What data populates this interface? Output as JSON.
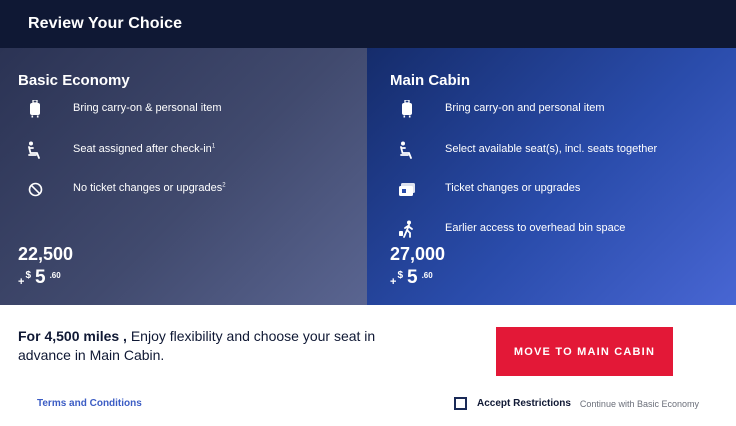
{
  "header": {
    "title": "Review Your Choice"
  },
  "basic": {
    "title": "Basic Economy",
    "features": [
      {
        "icon": "carry-on-bag-icon",
        "text": "Bring carry-on & personal item",
        "sup": ""
      },
      {
        "icon": "seat-icon",
        "text": "Seat assigned after check-in",
        "sup": "1"
      },
      {
        "icon": "no-symbol-icon",
        "text": "No ticket changes or upgrades",
        "sup": "2"
      }
    ],
    "miles": "22,500",
    "price": {
      "plus": "+",
      "currency": "$",
      "dollars": "5",
      "cents": ".60"
    }
  },
  "main": {
    "title": "Main Cabin",
    "features": [
      {
        "icon": "carry-on-bag-icon",
        "text": "Bring carry-on and personal item"
      },
      {
        "icon": "seat-icon",
        "text": "Select available seat(s), incl. seats together"
      },
      {
        "icon": "ticket-icon",
        "text": "Ticket changes or upgrades"
      },
      {
        "icon": "boarding-person-icon",
        "text": "Earlier access to overhead bin space"
      }
    ],
    "miles": "27,000",
    "price": {
      "plus": "+",
      "currency": "$",
      "dollars": "5",
      "cents": ".60"
    }
  },
  "upsell": {
    "highlight": "For 4,500 miles ,",
    "text": " Enjoy flexibility and choose your seat in advance in Main Cabin."
  },
  "cta": {
    "label": "MOVE TO MAIN CABIN"
  },
  "footer": {
    "terms": "Terms and Conditions",
    "accept_label": "Accept Restrictions",
    "accept_sub": "Continue with Basic Economy"
  },
  "colors": {
    "header_bg": "#0f1834",
    "cta": "#e31837",
    "link": "#3b5cc4"
  }
}
